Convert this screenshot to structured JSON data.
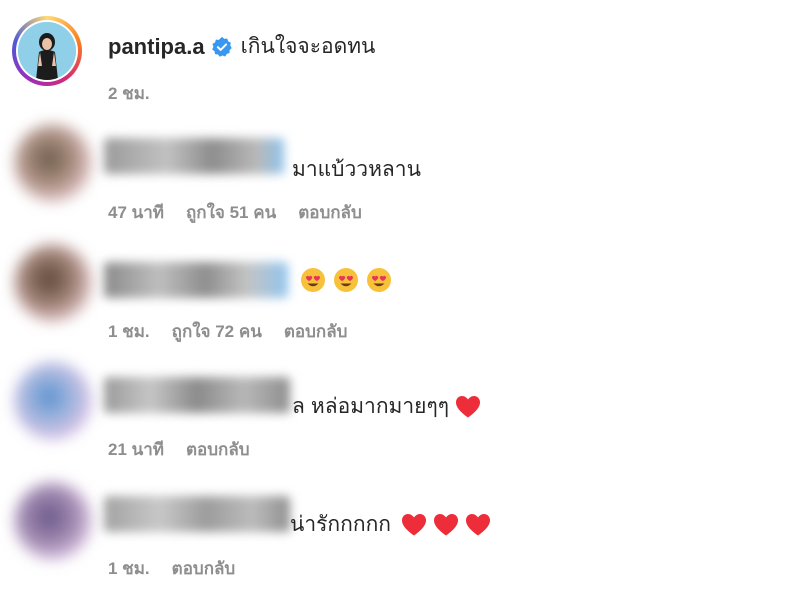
{
  "post": {
    "username": "pantipa.a",
    "caption": "เกินใจจะอดทน",
    "time": "2 ชม."
  },
  "comments": [
    {
      "text": "มาแบ้ววหลาน",
      "time": "47 นาที",
      "likes": "ถูกใจ 51 คน",
      "reply": "ตอบกลับ"
    },
    {
      "text": "",
      "emojis": [
        "heart-eyes-emoji",
        "heart-eyes-emoji",
        "heart-eyes-emoji"
      ],
      "time": "1 ชม.",
      "likes": "ถูกใจ 72 คน",
      "reply": "ตอบกลับ"
    },
    {
      "text_lead": "ล",
      "text": "หล่อมากมายๆๆ",
      "time": "21 นาที",
      "reply": "ตอบกลับ"
    },
    {
      "text": "น่ารักกกกก",
      "time": "1 ชม.",
      "reply": "ตอบกลับ"
    }
  ],
  "colors": {
    "text": "#262626",
    "meta": "#8e8e8e",
    "verified": "#3897f0",
    "heart": "#ed2d3a"
  },
  "icons": {
    "verified": "verified-badge-icon",
    "heart": "red-heart-icon",
    "emoji": "heart-eyes-emoji"
  }
}
